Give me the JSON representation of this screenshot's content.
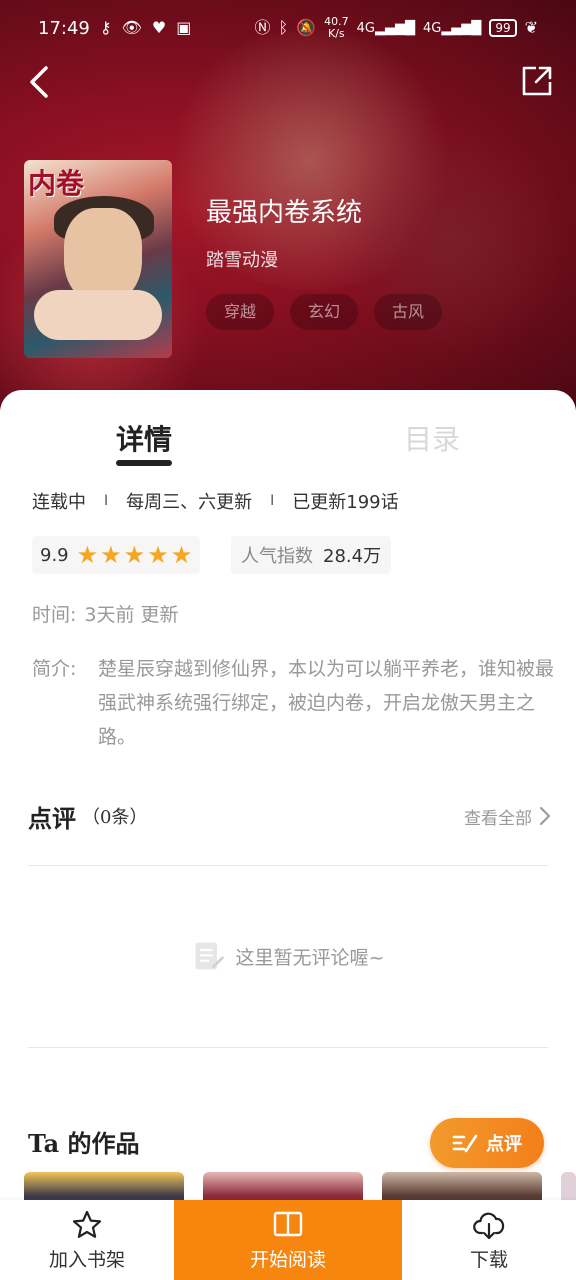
{
  "status_bar": {
    "time": "17:49",
    "net_speed": "40.7\nK/s",
    "net_speed_top": "40.7",
    "net_speed_bottom": "K/s",
    "signal1": "4G",
    "signal2": "4G",
    "battery": "99"
  },
  "book": {
    "title": "最强内卷系统",
    "author": "踏雪动漫",
    "cover_title": "内卷",
    "tags": [
      "穿越",
      "玄幻",
      "古风"
    ]
  },
  "tabs": {
    "detail": "详情",
    "catalog": "目录"
  },
  "meta": {
    "status": "连载中",
    "schedule": "每周三、六更新",
    "chapters": "已更新199话",
    "separator": "I"
  },
  "rating": {
    "score": "9.9",
    "stars": 5,
    "popularity_label": "人气指数",
    "popularity_value": "28.4万"
  },
  "time": {
    "label": "时间:",
    "value": "3天前 更新"
  },
  "intro": {
    "label": "简介:",
    "text": "楚星辰穿越到修仙界，本以为可以躺平养老，谁知被最强武神系统强行绑定，被迫内卷，开启龙傲天男主之路。"
  },
  "reviews": {
    "title": "点评",
    "count": "（0条）",
    "view_all": "查看全部",
    "empty": "这里暂无评论喔~",
    "float_button": "点评"
  },
  "works": {
    "title": "Ta 的作品"
  },
  "bottom_bar": {
    "add_shelf": "加入书架",
    "start_read": "开始阅读",
    "download": "下载"
  },
  "colors": {
    "accent": "#f7860f",
    "star": "#f5a623",
    "hero": "#8c1022"
  }
}
